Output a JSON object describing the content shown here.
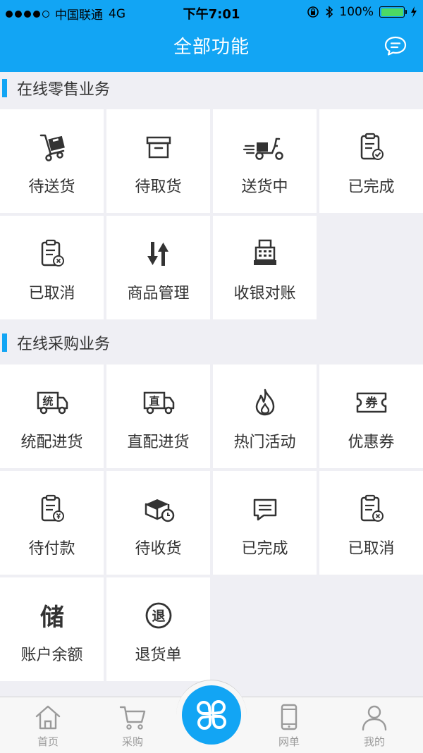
{
  "status_bar": {
    "carrier": "中国联通",
    "network": "4G",
    "time": "下午7:01",
    "battery_text": "100%"
  },
  "header": {
    "title": "全部功能",
    "message_icon": "chat-bubble-icon"
  },
  "sections": [
    {
      "title": "在线零售业务",
      "items": [
        {
          "label": "待送货",
          "icon": "hand-truck-icon"
        },
        {
          "label": "待取货",
          "icon": "box-icon"
        },
        {
          "label": "送货中",
          "icon": "scooter-icon"
        },
        {
          "label": "已完成",
          "icon": "clipboard-check-icon"
        },
        {
          "label": "已取消",
          "icon": "clipboard-cancel-icon"
        },
        {
          "label": "商品管理",
          "icon": "sort-arrows-icon"
        },
        {
          "label": "收银对账",
          "icon": "cash-register-icon"
        }
      ]
    },
    {
      "title": "在线采购业务",
      "items": [
        {
          "label": "统配进货",
          "icon": "truck-unified-icon",
          "badge": "统"
        },
        {
          "label": "直配进货",
          "icon": "truck-direct-icon",
          "badge": "直"
        },
        {
          "label": "热门活动",
          "icon": "flame-icon"
        },
        {
          "label": "优惠券",
          "icon": "coupon-icon",
          "badge": "券"
        },
        {
          "label": "待付款",
          "icon": "clipboard-yen-icon"
        },
        {
          "label": "待收货",
          "icon": "box-clock-icon"
        },
        {
          "label": "已完成",
          "icon": "message-list-icon"
        },
        {
          "label": "已取消",
          "icon": "clipboard-cancel-icon"
        },
        {
          "label": "账户余额",
          "icon": "deposit-icon",
          "badge": "储"
        },
        {
          "label": "退货单",
          "icon": "return-circle-icon",
          "badge": "退"
        }
      ]
    }
  ],
  "tabbar": [
    {
      "label": "首页",
      "icon": "home-icon"
    },
    {
      "label": "采购",
      "icon": "cart-icon"
    },
    {
      "label": "",
      "icon": "clover-grid-icon"
    },
    {
      "label": "网单",
      "icon": "phone-icon"
    },
    {
      "label": "我的",
      "icon": "user-icon"
    }
  ],
  "colors": {
    "accent": "#12a5f4",
    "background": "#efeff4",
    "tile": "#ffffff",
    "text": "#333333",
    "tab_text": "#9a9a9a"
  }
}
